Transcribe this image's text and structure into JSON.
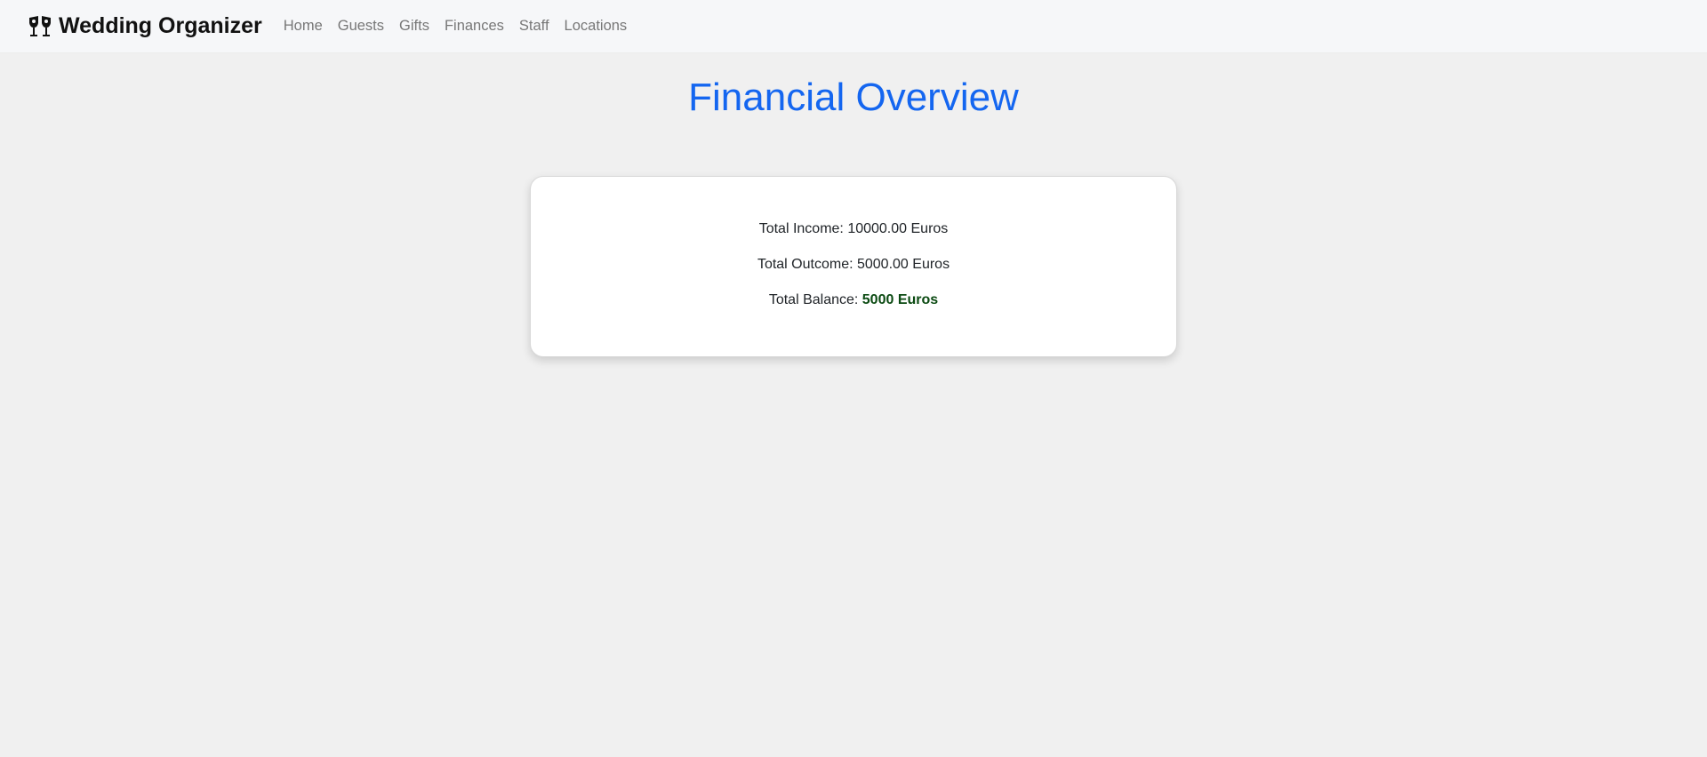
{
  "navbar": {
    "brand": "Wedding Organizer",
    "brand_icon": "clinking-glasses-icon",
    "links": [
      "Home",
      "Guests",
      "Gifts",
      "Finances",
      "Staff",
      "Locations"
    ]
  },
  "page": {
    "title": "Financial Overview",
    "title_color": "#1466f0"
  },
  "summary": {
    "income_label": "Total Income: ",
    "income_value": "10000.00 Euros",
    "outcome_label": "Total Outcome: ",
    "outcome_value": "5000.00 Euros",
    "balance_label": "Total Balance: ",
    "balance_value": "5000 Euros",
    "balance_color": "#0b4a12"
  }
}
